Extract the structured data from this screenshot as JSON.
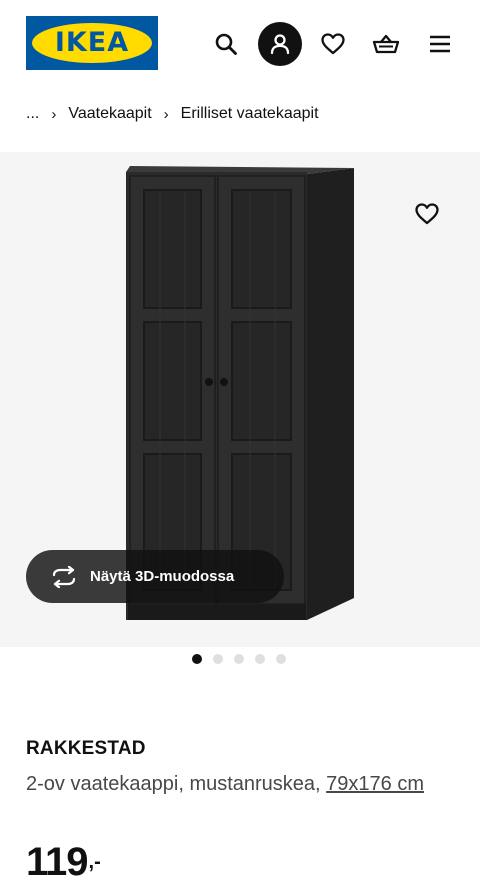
{
  "header": {
    "logo_text": "IKEA",
    "icons": [
      "search-icon",
      "profile-icon",
      "heart-icon",
      "basket-icon",
      "menu-icon"
    ]
  },
  "breadcrumb": {
    "ellipsis": "...",
    "items": [
      "Vaatekaapit",
      "Erilliset vaatekaapit"
    ],
    "separator": "›"
  },
  "gallery": {
    "view_3d_label": "Näytä 3D-muodossa",
    "image_count": 5,
    "active_index": 0
  },
  "product": {
    "name": "RAKKESTAD",
    "description": "2-ov vaatekaappi, mustanruskea, ",
    "dimensions": "79x176 cm",
    "price_integer": "119",
    "price_suffix": ",-"
  },
  "colors": {
    "logo_blue": "#0058a3",
    "logo_yellow": "#ffdb00",
    "wardrobe_color": "#2b2b2b"
  }
}
